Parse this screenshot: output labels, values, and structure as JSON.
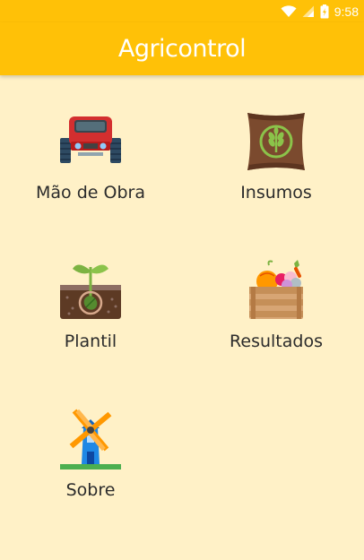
{
  "status_bar": {
    "time": "9:58",
    "icons": [
      "wifi-icon",
      "signal-icon",
      "battery-icon"
    ]
  },
  "app_bar": {
    "title": "Agricontrol",
    "color": "#FFC107"
  },
  "background_color": "#FFF1C7",
  "menu": {
    "items": [
      {
        "label": "Mão de Obra",
        "icon": "tractor-icon"
      },
      {
        "label": "Insumos",
        "icon": "seed-sack-icon"
      },
      {
        "label": "Plantil",
        "icon": "sprout-icon"
      },
      {
        "label": "Resultados",
        "icon": "harvest-crate-icon"
      },
      {
        "label": "Sobre",
        "icon": "windmill-icon"
      }
    ]
  }
}
